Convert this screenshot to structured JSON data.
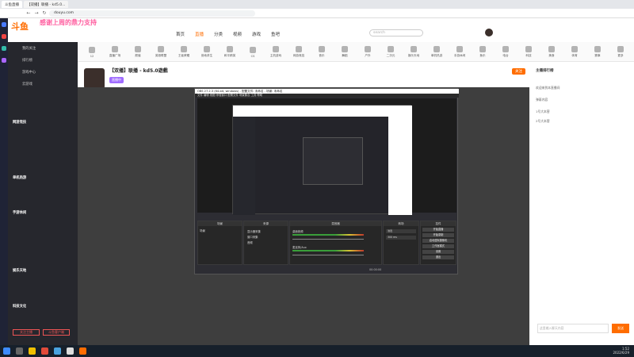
{
  "browser": {
    "tabs": [
      "斗鱼直播",
      "【双播】联播 - kd5.0..."
    ],
    "url": "douyu.com"
  },
  "site": {
    "logo": "斗鱼",
    "banner": "感谢上周的鼎力支持",
    "nav": [
      "首页",
      "直播",
      "分类",
      "视频",
      "游戏",
      "鱼吧"
    ],
    "search_placeholder": "search"
  },
  "categories": [
    "12",
    "直播广场",
    "颜值",
    "英雄联盟",
    "王者荣耀",
    "绝地求生",
    "和平精英",
    "CS",
    "主机游戏",
    "网游竞技",
    "音乐",
    "舞蹈",
    "户外",
    "二次元",
    "娱乐天地",
    "单机热游",
    "手游休闲",
    "鱼乐",
    "电台",
    "科技",
    "美食",
    "体育",
    "赛事",
    "更多"
  ],
  "sidebar": {
    "top": [
      "我的关注",
      "排行榜",
      "游戏中心",
      "云游戏"
    ],
    "section1": "网游竞技",
    "section2": "单机热游",
    "section3": "手游休闲",
    "section4": "娱乐天地",
    "section5": "科技文化",
    "footer_buttons": [
      "关注主播",
      "斗鱼客户端"
    ]
  },
  "room": {
    "title": "【双播】联播 - kd5.0遊戲",
    "follow": "关注",
    "tag": "直播中"
  },
  "obs": {
    "title": "OBS 27.2.3 (64-bit, windows) - 配置文件: 未命名 - 场景: 未命名",
    "menu": "文件  编辑  视图  停靠窗口  配置文件  场景集合  工具  帮助",
    "panels": [
      "场景",
      "来源",
      "混音器",
      "转场",
      "控件"
    ],
    "scene": "场景",
    "sources": [
      "显示器采集",
      "窗口采集",
      "音频"
    ],
    "mixer": [
      "桌面音频",
      "麦克风/Aux"
    ],
    "transition": "淡出",
    "duration": "300 ms",
    "controls": [
      "开始直播",
      "开始录制",
      "启动虚拟摄像机",
      "工作室模式",
      "设置",
      "退出"
    ],
    "status": "00:00:00"
  },
  "chat": {
    "header": "主播排行榜",
    "messages": [
      "欢迎来到本直播间",
      "弹幕内容",
      "1号大本营",
      "2号大本营"
    ],
    "input_placeholder": "这里输入聊天内容",
    "send": "发送"
  },
  "clock": {
    "time": "1:52",
    "date": "2022/6/29"
  },
  "colors": {
    "accent": "#ff6d00",
    "pink": "#ff5fa0",
    "obs_bg": "#2d2d33"
  }
}
